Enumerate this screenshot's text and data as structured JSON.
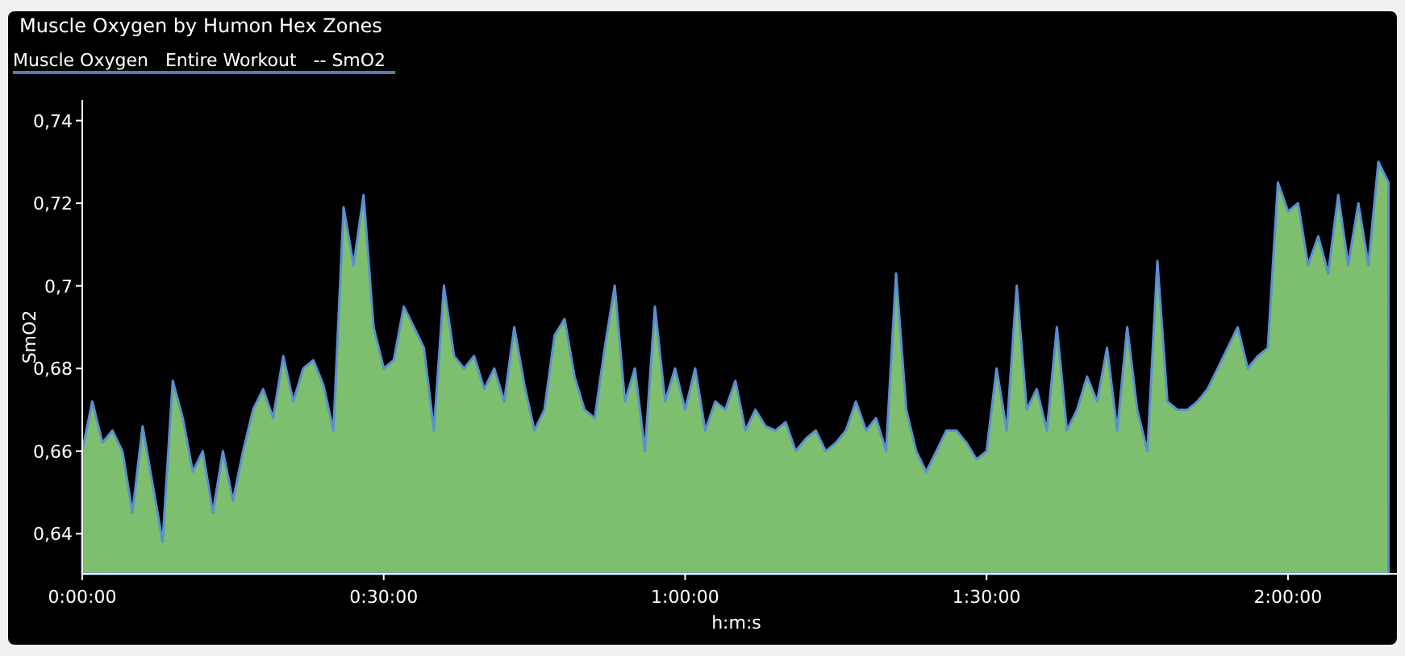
{
  "panel": {
    "title": "Muscle Oxygen by Humon Hex Zones",
    "chart_data": {
      "type": "area",
      "xlabel": "h:m:s",
      "ylabel": "SmO2",
      "xlim": [
        0,
        130.2
      ],
      "ylim": [
        0.6303,
        0.745
      ],
      "xticks": [
        {
          "value": 0,
          "label": "0:00:00"
        },
        {
          "value": 30,
          "label": "0:30:00"
        },
        {
          "value": 60,
          "label": "1:00:00"
        },
        {
          "value": 90,
          "label": "1:30:00"
        },
        {
          "value": 120,
          "label": "2:00:00"
        }
      ],
      "yticks": [
        {
          "value": 0.64,
          "label": "0,64"
        },
        {
          "value": 0.66,
          "label": "0,66"
        },
        {
          "value": 0.68,
          "label": "0,68"
        },
        {
          "value": 0.7,
          "label": "0,7"
        },
        {
          "value": 0.72,
          "label": "0,72"
        },
        {
          "value": 0.74,
          "label": "0,74"
        }
      ],
      "x": [
        0,
        1,
        2,
        3,
        4,
        5,
        6,
        7,
        8,
        9,
        10,
        11,
        12,
        13,
        14,
        15,
        16,
        17,
        18,
        19,
        20,
        21,
        22,
        23,
        24,
        25,
        26,
        27,
        28,
        29,
        30,
        31,
        32,
        33,
        34,
        35,
        36,
        37,
        38,
        39,
        40,
        41,
        42,
        43,
        44,
        45,
        46,
        47,
        48,
        49,
        50,
        51,
        52,
        53,
        54,
        55,
        56,
        57,
        58,
        59,
        60,
        61,
        62,
        63,
        64,
        65,
        66,
        67,
        68,
        69,
        70,
        71,
        72,
        73,
        74,
        75,
        76,
        77,
        78,
        79,
        80,
        81,
        82,
        83,
        84,
        85,
        86,
        87,
        88,
        89,
        90,
        91,
        92,
        93,
        94,
        95,
        96,
        97,
        98,
        99,
        100,
        101,
        102,
        103,
        104,
        105,
        106,
        107,
        108,
        109,
        110,
        111,
        112,
        113,
        114,
        115,
        116,
        117,
        118,
        119,
        120,
        121,
        122,
        123,
        124,
        125,
        126,
        127,
        128,
        129,
        130
      ],
      "series": [
        {
          "name": "Muscle Oxygen   Entire Workout   -- SmO2",
          "color": "#7dbf6e",
          "values": [
            0.66,
            0.672,
            0.662,
            0.665,
            0.66,
            0.645,
            0.666,
            0.652,
            0.638,
            0.677,
            0.668,
            0.655,
            0.66,
            0.645,
            0.66,
            0.648,
            0.66,
            0.67,
            0.675,
            0.668,
            0.683,
            0.672,
            0.68,
            0.682,
            0.676,
            0.665,
            0.719,
            0.705,
            0.722,
            0.69,
            0.68,
            0.682,
            0.695,
            0.69,
            0.685,
            0.665,
            0.7,
            0.683,
            0.68,
            0.683,
            0.675,
            0.68,
            0.672,
            0.69,
            0.676,
            0.665,
            0.67,
            0.688,
            0.692,
            0.678,
            0.67,
            0.668,
            0.685,
            0.7,
            0.672,
            0.68,
            0.66,
            0.695,
            0.672,
            0.68,
            0.67,
            0.68,
            0.665,
            0.672,
            0.67,
            0.677,
            0.665,
            0.67,
            0.666,
            0.665,
            0.667,
            0.66,
            0.663,
            0.665,
            0.66,
            0.662,
            0.665,
            0.672,
            0.665,
            0.668,
            0.66,
            0.703,
            0.67,
            0.66,
            0.655,
            0.66,
            0.665,
            0.665,
            0.662,
            0.658,
            0.66,
            0.68,
            0.665,
            0.7,
            0.67,
            0.675,
            0.665,
            0.69,
            0.665,
            0.67,
            0.678,
            0.672,
            0.685,
            0.665,
            0.69,
            0.67,
            0.66,
            0.706,
            0.672,
            0.67,
            0.67,
            0.672,
            0.675,
            0.68,
            0.685,
            0.69,
            0.68,
            0.683,
            0.685,
            0.725,
            0.718,
            0.72,
            0.705,
            0.712,
            0.703,
            0.722,
            0.705,
            0.72,
            0.705,
            0.73,
            0.725
          ]
        }
      ]
    }
  }
}
